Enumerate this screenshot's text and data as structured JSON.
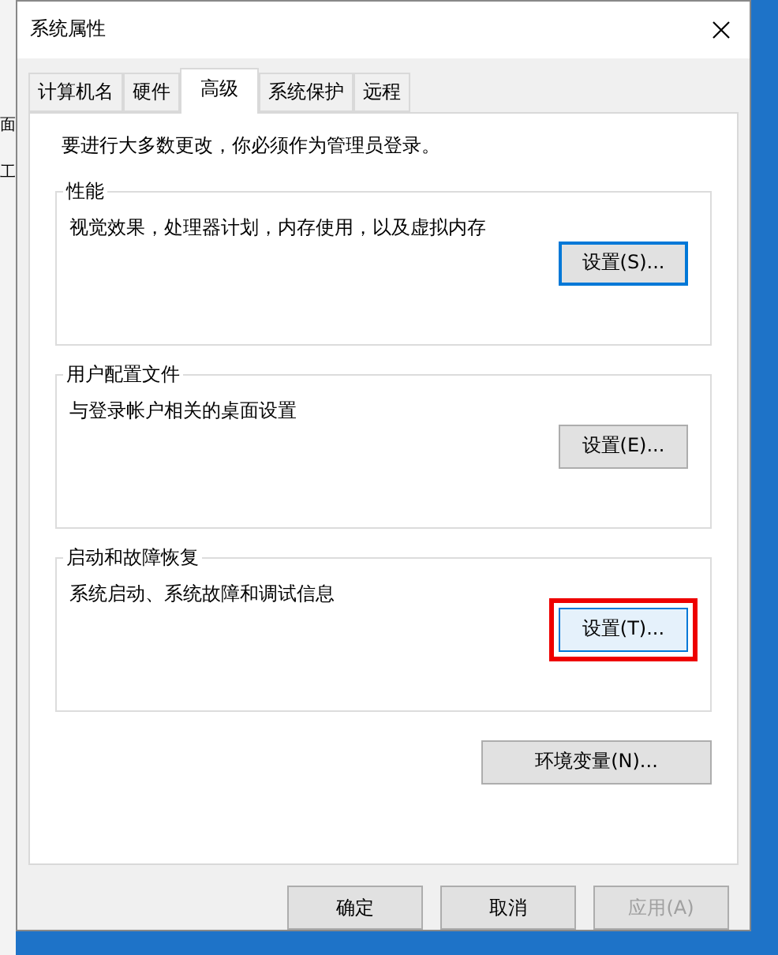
{
  "background_window": {
    "texts": [
      "面",
      "工"
    ]
  },
  "window": {
    "title": "系统属性"
  },
  "tabs": [
    {
      "label": "计算机名",
      "selected": false
    },
    {
      "label": "硬件",
      "selected": false
    },
    {
      "label": "高级",
      "selected": true
    },
    {
      "label": "系统保护",
      "selected": false
    },
    {
      "label": "远程",
      "selected": false
    }
  ],
  "notice": "要进行大多数更改，你必须作为管理员登录。",
  "groups": [
    {
      "title": "性能",
      "description": "视觉效果，处理器计划，内存使用，以及虚拟内存",
      "button": {
        "label": "设置(S)...",
        "focused": true,
        "highlighted": false
      }
    },
    {
      "title": "用户配置文件",
      "description": "与登录帐户相关的桌面设置",
      "button": {
        "label": "设置(E)...",
        "focused": false,
        "highlighted": false
      }
    },
    {
      "title": "启动和故障恢复",
      "description": "系统启动、系统故障和调试信息",
      "button": {
        "label": "设置(T)...",
        "focused": false,
        "highlighted": true
      }
    }
  ],
  "env_button": "环境变量(N)...",
  "buttons": [
    {
      "label": "确定",
      "disabled": false
    },
    {
      "label": "取消",
      "disabled": false
    },
    {
      "label": "应用(A)",
      "disabled": true
    }
  ]
}
